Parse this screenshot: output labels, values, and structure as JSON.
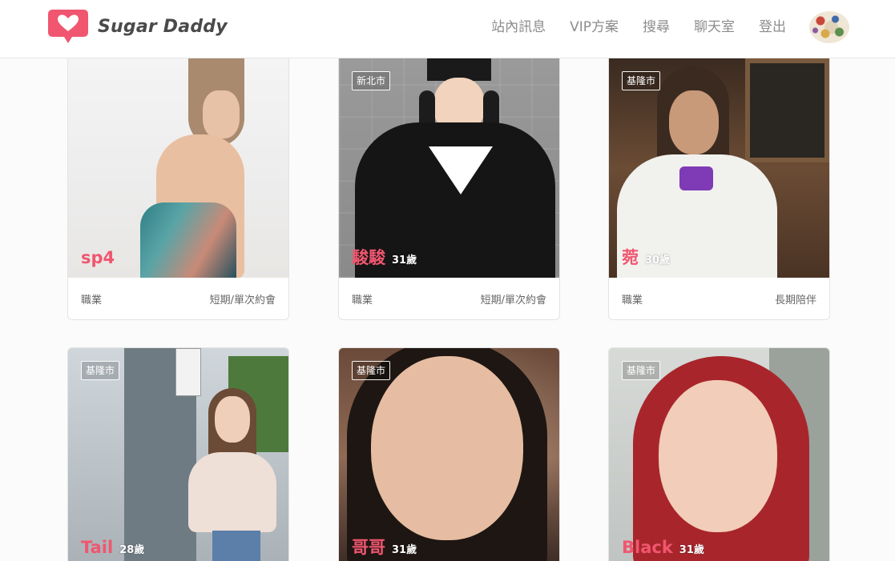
{
  "header": {
    "brand_name": "Sugar Daddy",
    "logo_icon": "heart-chat-icon",
    "nav": [
      {
        "label": "站內訊息"
      },
      {
        "label": "VIP方案"
      },
      {
        "label": "搜尋"
      },
      {
        "label": "聊天室"
      },
      {
        "label": "登出"
      }
    ],
    "avatar_icon": "user-avatar"
  },
  "colors": {
    "brand_red": "#f0566f",
    "header_bg": "#ffffff",
    "page_bg": "#fbfbfb",
    "nav_text": "#8c8c8c"
  },
  "cards": [
    {
      "city": "",
      "nickname": "sp4",
      "age": "",
      "job_label": "職業",
      "tag": "短期/單次約會"
    },
    {
      "city": "新北市",
      "nickname": "駿駿",
      "age": "31歲",
      "job_label": "職業",
      "tag": "短期/單次約會"
    },
    {
      "city": "基隆市",
      "nickname": "菀",
      "age": "30歲",
      "job_label": "職業",
      "tag": "長期陪伴"
    },
    {
      "city": "基隆市",
      "nickname": "Tail",
      "age": "28歲",
      "job_label": "",
      "tag": ""
    },
    {
      "city": "基隆市",
      "nickname": "哥哥",
      "age": "31歲",
      "job_label": "",
      "tag": ""
    },
    {
      "city": "基隆市",
      "nickname": "Black",
      "age": "31歲",
      "job_label": "",
      "tag": ""
    }
  ]
}
